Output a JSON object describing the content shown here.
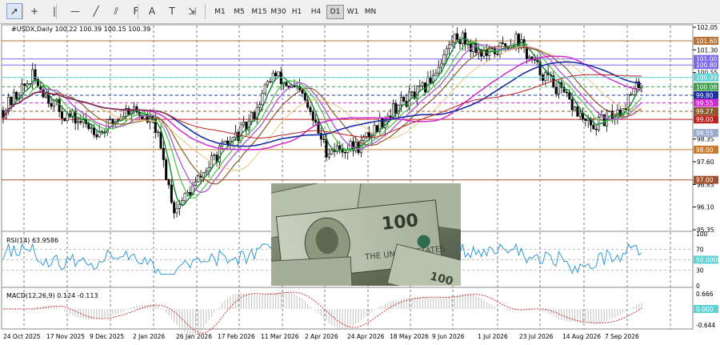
{
  "toolbar": {
    "tools": [
      {
        "name": "cursor-icon",
        "glyph": "➚"
      },
      {
        "name": "crosshair-icon",
        "glyph": "+"
      },
      {
        "name": "vertical-line-icon",
        "glyph": "|"
      },
      {
        "name": "horizontal-line-icon",
        "glyph": "—"
      },
      {
        "name": "trendline-icon",
        "glyph": "╱"
      },
      {
        "name": "channel-icon",
        "glyph": "⫽"
      },
      {
        "name": "fibonacci-icon",
        "glyph": "F"
      },
      {
        "name": "text-icon",
        "glyph": "A"
      },
      {
        "name": "text-label-icon",
        "glyph": "T"
      },
      {
        "name": "shapes-icon",
        "glyph": "⇲"
      }
    ],
    "timeframes": [
      "M1",
      "M5",
      "M15",
      "M30",
      "H1",
      "H4",
      "D1",
      "W1",
      "MN"
    ],
    "active_timeframe": "D1"
  },
  "chart": {
    "header": "#USDX,Daily  100.22 100.39 100.15 100.39",
    "price_ticks": [
      "102.05",
      "101.30",
      "100.55",
      "99.80",
      "98.35",
      "97.60",
      "96.85",
      "96.10",
      "95.35"
    ],
    "level_tags": [
      {
        "text": "101.60",
        "color": "#b87333"
      },
      {
        "text": "101.00",
        "color": "#7b68ee"
      },
      {
        "text": "100.80",
        "color": "#7b68ee"
      },
      {
        "text": "100.39",
        "color": "#5fd3d3"
      },
      {
        "text": "100.08",
        "color": "#3aa04a"
      },
      {
        "text": "99.80",
        "color": "#1a2fa8"
      },
      {
        "text": "99.55",
        "color": "#d02ad0"
      },
      {
        "text": "99.27",
        "color": "#8a5a2e"
      },
      {
        "text": "99.00",
        "color": "#c02020"
      },
      {
        "text": "98.55",
        "color": "#9aaacc"
      },
      {
        "text": "98.00",
        "color": "#c87a2a"
      },
      {
        "text": "97.00",
        "color": "#a0522d"
      }
    ],
    "date_labels": [
      "24 Oct 2025",
      "17 Nov 2025",
      "9 Dec 2025",
      "2 Jan 2026",
      "26 Jan 2026",
      "17 Feb 2026",
      "11 Mar 2026",
      "2 Apr 2026",
      "24 Apr 2026",
      "18 May 2026",
      "9 Jun 2026",
      "1 Jul 2026",
      "23 Jul 2026",
      "14 Aug 2026",
      "7 Sep 2026"
    ]
  },
  "rsi": {
    "label": "RSI(14) 63.9586",
    "ticks": [
      "100",
      "70",
      "50.0000",
      "30",
      "0"
    ],
    "color": "#1e8fd6"
  },
  "macd": {
    "label": "MACD(12,26,9) 0.124 -0.113",
    "ticks": [
      "0.666",
      "0.000",
      "-0.644"
    ],
    "signal_color": "#c82020"
  },
  "image": {
    "subject": "us-dollar-banknotes"
  }
}
